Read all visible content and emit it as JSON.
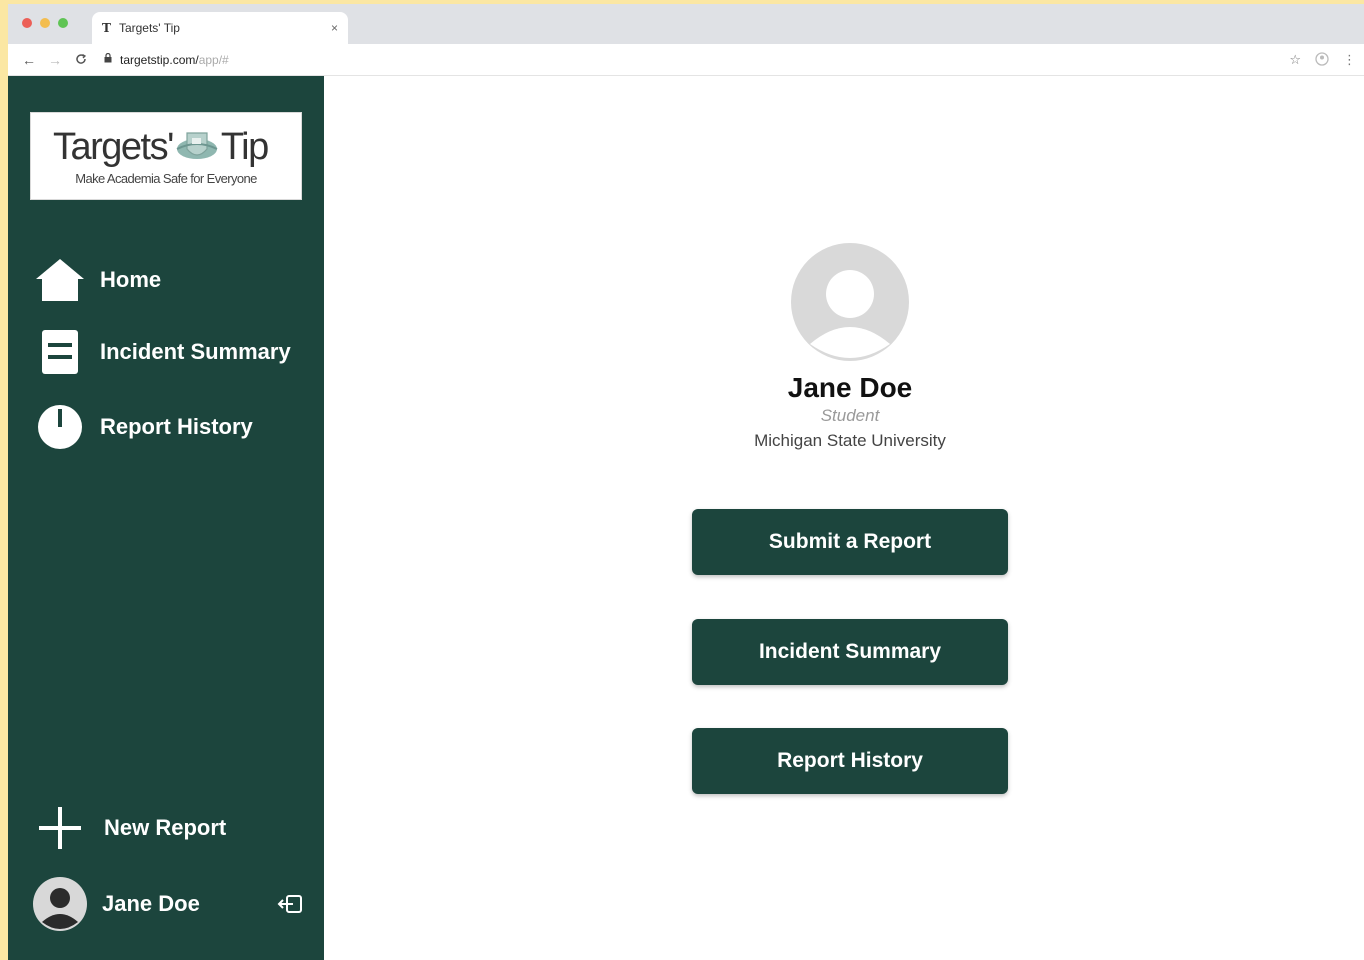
{
  "browser": {
    "tab_title": "Targets' Tip",
    "tab_favicon": "T",
    "tab_close": "×",
    "url_host": "targetstip.com/",
    "url_path": "app/#",
    "back": "←",
    "forward": "→",
    "reload": "C"
  },
  "logo": {
    "word1": "Targets'",
    "word2": "Tip",
    "tagline": "Make Academia Safe for Everyone"
  },
  "sidebar": {
    "items": [
      {
        "label": "Home",
        "icon": "home-icon"
      },
      {
        "label": "Incident Summary",
        "icon": "document-icon"
      },
      {
        "label": "Report History",
        "icon": "clock-icon"
      }
    ],
    "new_report": {
      "label": "New Report",
      "icon": "plus-icon"
    },
    "user": {
      "name": "Jane Doe",
      "icon": "avatar-icon",
      "logout_icon": "logout-icon"
    }
  },
  "profile": {
    "name": "Jane Doe",
    "role": "Student",
    "school": "Michigan State University"
  },
  "actions": {
    "submit": "Submit a Report",
    "incident": "Incident Summary",
    "history": "Report History"
  },
  "colors": {
    "sidebar": "#1c453d",
    "button": "#1c453d",
    "page_frame": "#fbe7a3"
  }
}
